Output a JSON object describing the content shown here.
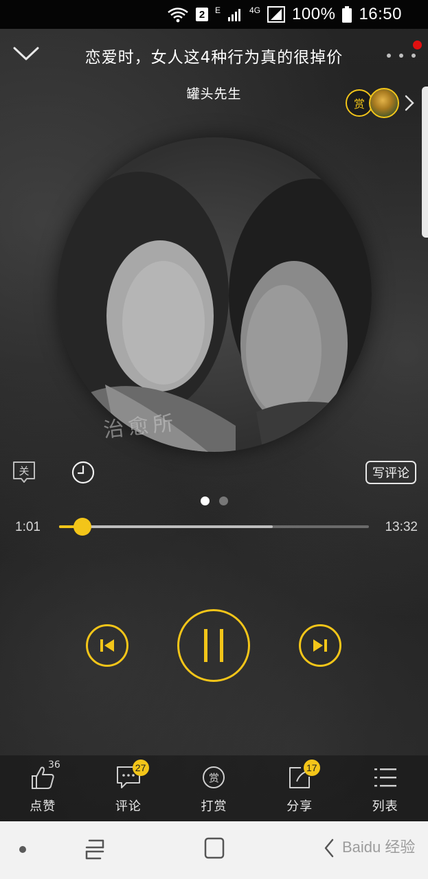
{
  "status_bar": {
    "sim_badge": "2",
    "network_e": "E",
    "network_4g": "4G",
    "battery_text": "100%",
    "time": "16:50"
  },
  "header": {
    "title": "恋爱时，女人这4种行为真的很掉价",
    "author": "罐头先生",
    "reward_badge_label": "赏"
  },
  "album": {
    "watermark": "治愈所"
  },
  "controls_row": {
    "toggle_label": "关",
    "write_comment_label": "写评论"
  },
  "pager": {
    "count": 2,
    "active_index": 0
  },
  "progress": {
    "current_time": "1:01",
    "total_time": "13:32",
    "played_fraction": 0.075,
    "buffered_fraction": 0.69
  },
  "actions": {
    "like": {
      "label": "点赞",
      "count": "36"
    },
    "comment": {
      "label": "评论",
      "count": "27"
    },
    "reward": {
      "label": "打赏",
      "icon_text": "赏"
    },
    "share": {
      "label": "分享",
      "count": "17"
    },
    "list": {
      "label": "列表"
    }
  },
  "nav_bar": {
    "watermark": "Baidu 经验"
  },
  "colors": {
    "accent": "#f3c519",
    "notification": "#e01010"
  }
}
